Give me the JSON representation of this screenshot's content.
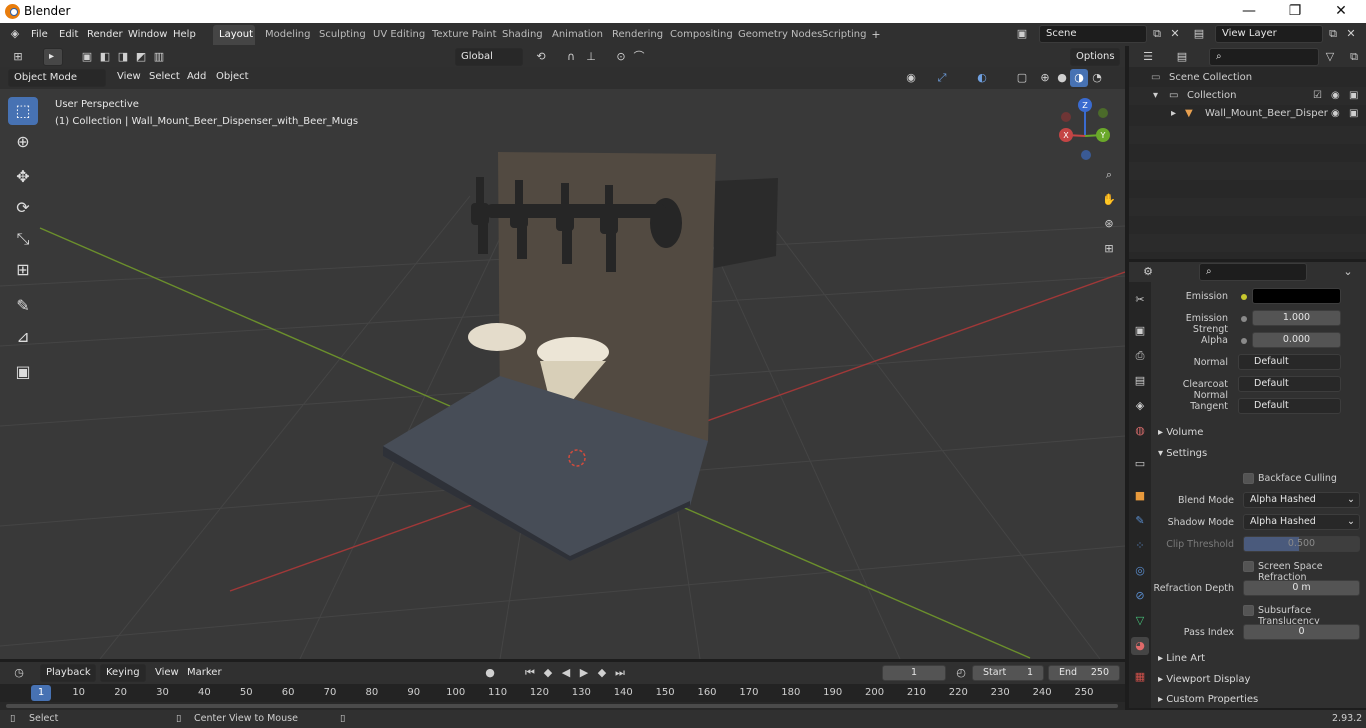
{
  "window": {
    "title": "Blender",
    "minimize": "—",
    "maximize": "❐",
    "close": "✕"
  },
  "menus": [
    "File",
    "Edit",
    "Render",
    "Window",
    "Help"
  ],
  "workspaces": [
    "Layout",
    "Modeling",
    "Sculpting",
    "UV Editing",
    "Texture Paint",
    "Shading",
    "Animation",
    "Rendering",
    "Compositing",
    "Geometry Nodes",
    "Scripting"
  ],
  "active_workspace": "Layout",
  "scene": {
    "name": "Scene",
    "view_layer": "View Layer"
  },
  "viewport": {
    "mode": "Object Mode",
    "menu": [
      "View",
      "Select",
      "Add",
      "Object"
    ],
    "orientation": "Global",
    "options": "Options",
    "overlay_title": "User Perspective",
    "overlay_subtitle": "(1) Collection | Wall_Mount_Beer_Dispenser_with_Beer_Mugs",
    "gizmo": {
      "z": "Z",
      "y": "Y",
      "x": "X"
    }
  },
  "outliner": {
    "items": [
      {
        "label": "Scene Collection",
        "icon": "scene-collection-icon"
      },
      {
        "label": "Collection",
        "icon": "collection-icon"
      },
      {
        "label": "Wall_Mount_Beer_Disper",
        "icon": "object-icon"
      }
    ]
  },
  "properties": {
    "fields": [
      {
        "label": "Emission",
        "value": ""
      },
      {
        "label": "Emission Strengt",
        "value": "1.000"
      },
      {
        "label": "Alpha",
        "value": "0.000"
      },
      {
        "label": "Normal",
        "value": "Default"
      },
      {
        "label": "Clearcoat Normal",
        "value": "Default"
      },
      {
        "label": "Tangent",
        "value": "Default"
      }
    ],
    "volume": "Volume",
    "settings": "Settings",
    "backface": "Backface Culling",
    "blend_label": "Blend Mode",
    "blend_value": "Alpha Hashed",
    "shadow_label": "Shadow Mode",
    "shadow_value": "Alpha Hashed",
    "clip_label": "Clip Threshold",
    "clip_value": "0.500",
    "ssr": "Screen Space Refraction",
    "refr_label": "Refraction Depth",
    "refr_value": "0 m",
    "sss": "Subsurface Translucency",
    "pass_label": "Pass Index",
    "pass_value": "0",
    "line_art": "Line Art",
    "viewport_display": "Viewport Display",
    "custom_props": "Custom Properties"
  },
  "timeline": {
    "menus": [
      "Playback",
      "Keying",
      "View",
      "Marker"
    ],
    "current_frame": "1",
    "start_label": "Start",
    "start": "1",
    "end_label": "End",
    "end": "250",
    "ruler": [
      "1",
      "10",
      "20",
      "30",
      "40",
      "50",
      "60",
      "70",
      "80",
      "90",
      "100",
      "110",
      "120",
      "130",
      "140",
      "150",
      "160",
      "170",
      "180",
      "190",
      "200",
      "210",
      "220",
      "230",
      "240",
      "250"
    ]
  },
  "status": {
    "left": "Select",
    "middle": "Center View to Mouse",
    "version": "2.93.2"
  },
  "colors": {
    "accent": "#4772b3",
    "viewport_bg": "#393939",
    "panel": "#303030"
  }
}
